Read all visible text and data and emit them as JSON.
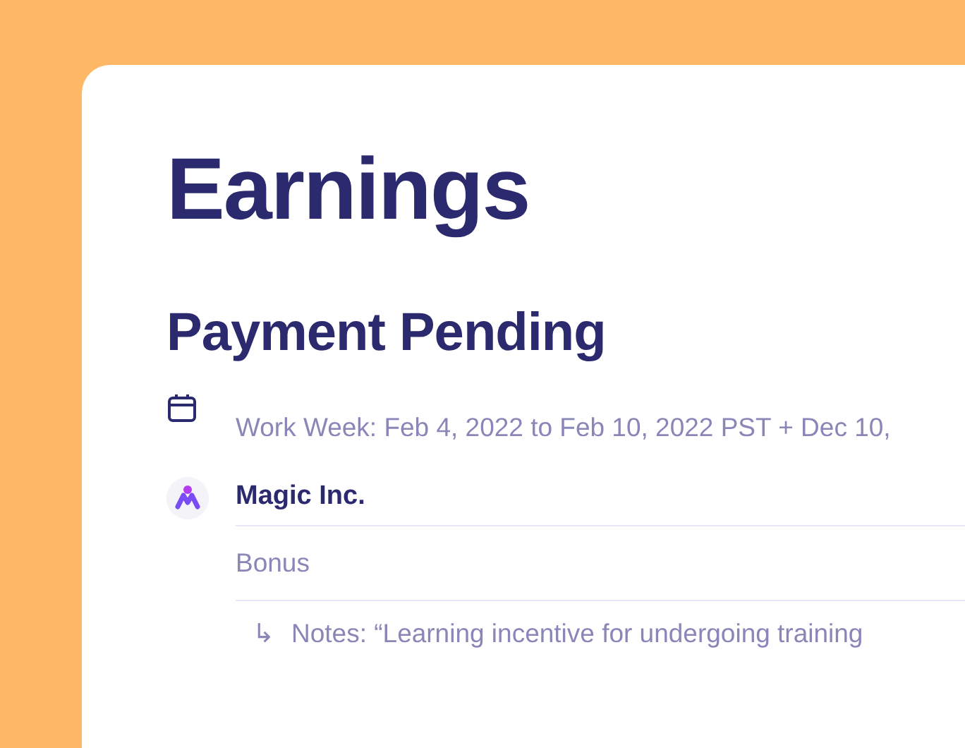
{
  "title": "Earnings",
  "section": {
    "title": "Payment Pending",
    "period": "Work Week: Feb 4, 2022 to Feb 10, 2022 PST + Dec 10,"
  },
  "payer": {
    "name": "Magic Inc.",
    "item": "Bonus",
    "notes_arrow": "↳",
    "notes": "Notes: “Learning incentive for undergoing training"
  }
}
